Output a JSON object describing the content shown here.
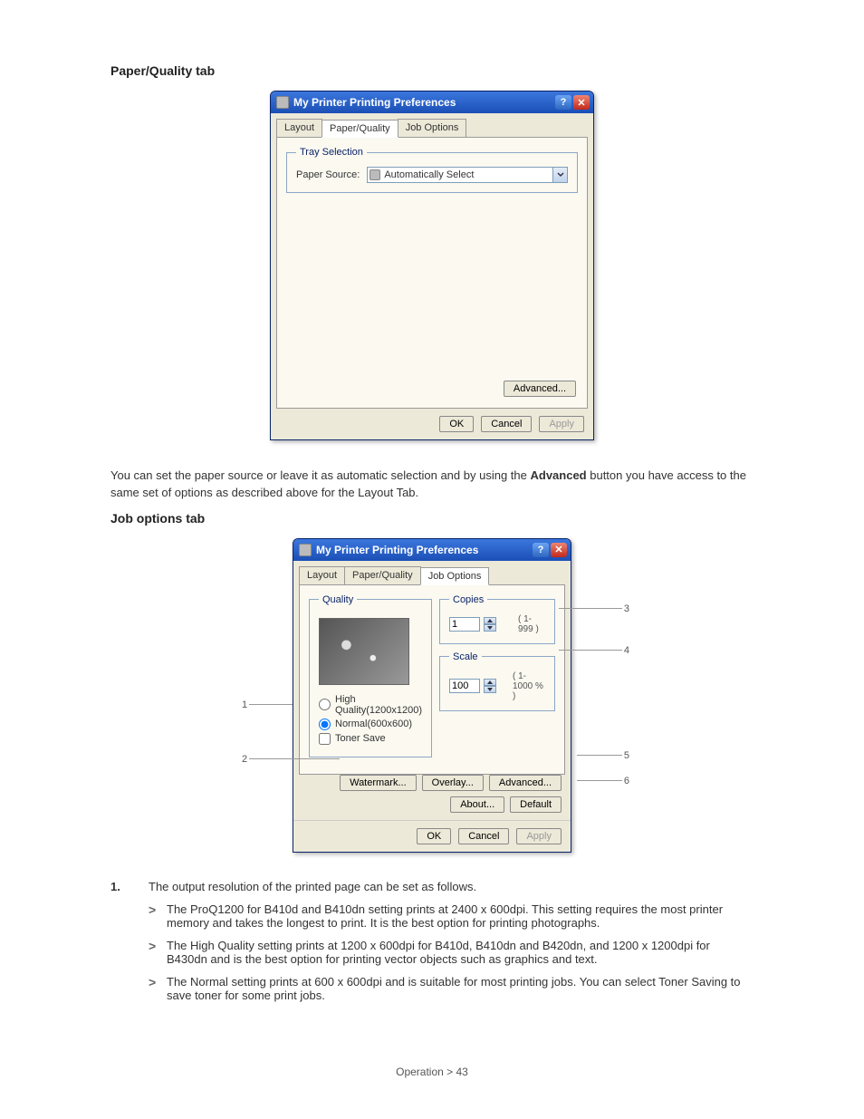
{
  "section1_heading": "Paper/Quality tab",
  "section2_heading": "Job options tab",
  "win1": {
    "title": "My Printer Printing Preferences",
    "help_glyph": "?",
    "close_glyph": "✕",
    "tabs": {
      "layout": "Layout",
      "pq": "Paper/Quality",
      "job": "Job Options"
    },
    "group_tray": "Tray Selection",
    "lbl_paper_source": "Paper Source:",
    "combo_value": "Automatically Select",
    "btn_advanced": "Advanced...",
    "btn_ok": "OK",
    "btn_cancel": "Cancel",
    "btn_apply": "Apply"
  },
  "para1_prefix": "You can set the paper source or leave it as automatic selection and by using the ",
  "para1_bold": "Advanced",
  "para1_suffix": " button you have access to the same set of options as described above for the Layout Tab.",
  "win2": {
    "title": "My Printer Printing Preferences",
    "help_glyph": "?",
    "close_glyph": "✕",
    "tabs": {
      "layout": "Layout",
      "pq": "Paper/Quality",
      "job": "Job Options"
    },
    "group_quality": "Quality",
    "radio_hq": "High Quality(1200x1200)",
    "radio_normal": "Normal(600x600)",
    "check_toner": "Toner Save",
    "group_copies": "Copies",
    "copies_value": "1",
    "copies_range": "( 1-999 )",
    "group_scale": "Scale",
    "scale_value": "100",
    "scale_range": "( 1-1000 % )",
    "btn_watermark": "Watermark...",
    "btn_overlay": "Overlay...",
    "btn_advanced": "Advanced...",
    "btn_about": "About...",
    "btn_default": "Default",
    "btn_ok": "OK",
    "btn_cancel": "Cancel",
    "btn_apply": "Apply"
  },
  "callouts": {
    "c1": "1",
    "c2": "2",
    "c3": "3",
    "c4": "4",
    "c5": "5",
    "c6": "6"
  },
  "list": {
    "n1": "1.",
    "item1_intro": "The output resolution of the printed page can be set as follows.",
    "b1": "The ProQ1200 for B410d and B410dn setting prints at 2400 x 600dpi. This setting requires the most printer memory and takes the longest to print. It is the best option for printing photographs.",
    "b2": "The High Quality setting prints at 1200 x 600dpi for B410d, B410dn and B420dn, and 1200 x 1200dpi for B430dn and is the best option for printing vector objects such as graphics and text.",
    "b3": "The Normal setting prints at 600 x 600dpi and is suitable for most printing jobs. You can select Toner Saving to save toner for some print jobs."
  },
  "footer": "Operation > 43"
}
